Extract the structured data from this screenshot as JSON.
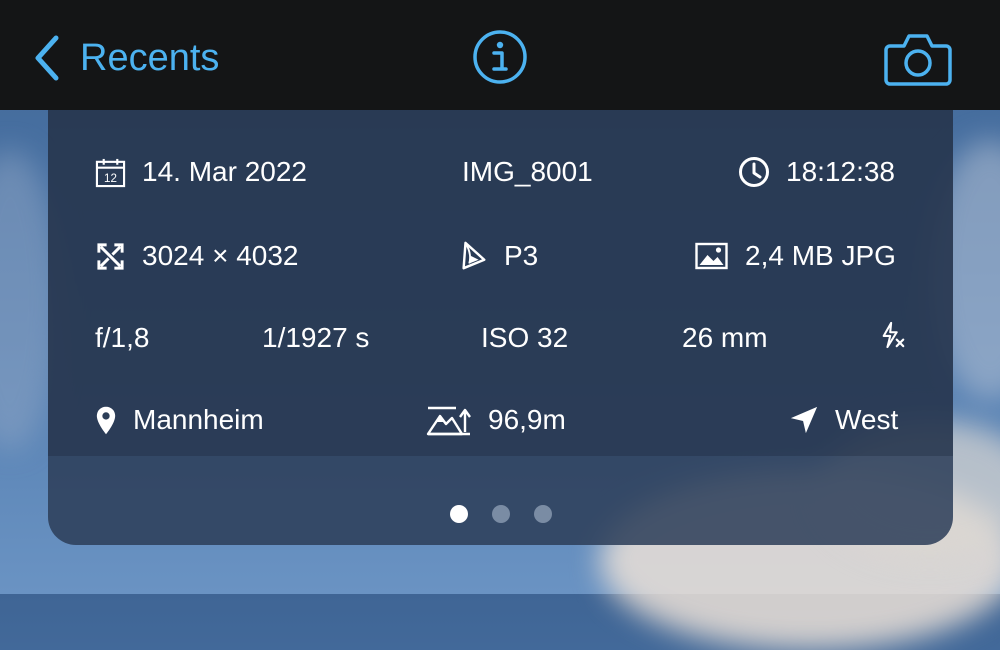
{
  "colors": {
    "accent": "#4cb2f0",
    "bar": "#141516",
    "panel": "#2c3e58",
    "text": "#ffffff"
  },
  "nav": {
    "back_label": "Recents",
    "info_icon": "info-circle-icon",
    "camera_icon": "camera-icon"
  },
  "metadata": {
    "date": "14. Mar 2022",
    "filename": "IMG_8001",
    "time": "18:12:38",
    "dimensions": "3024 × 4032",
    "color_profile": "P3",
    "file_info": "2,4 MB JPG",
    "aperture": "f/1,8",
    "shutter": "1/1927 s",
    "iso": "ISO 32",
    "focal_length": "26 mm",
    "location": "Mannheim",
    "altitude": "96,9m",
    "direction": "West",
    "calendar_day": "12"
  },
  "pager": {
    "pages": 3,
    "active": 0
  }
}
